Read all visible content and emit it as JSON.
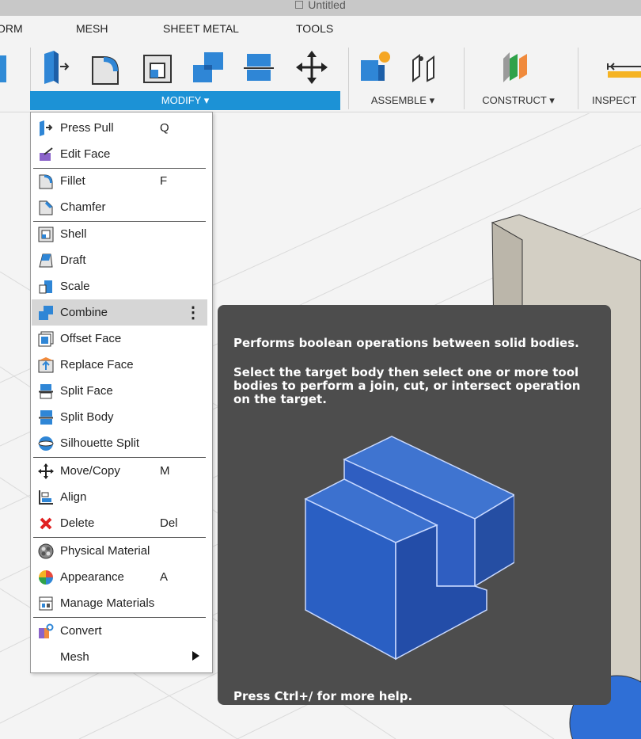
{
  "window": {
    "title": "Untitled"
  },
  "ribbon": {
    "tabs": [
      "ORM",
      "MESH",
      "SHEET METAL",
      "TOOLS"
    ],
    "groups": {
      "modify": "MODIFY ▾",
      "assemble": "ASSEMBLE ▾",
      "construct": "CONSTRUCT ▾",
      "inspect": "INSPECT"
    },
    "tool_icons": [
      "press-pull-icon",
      "fillet-icon",
      "shell-icon",
      "combine-icon",
      "split-body-icon",
      "move-icon",
      "new-component-icon",
      "joint-icon",
      "offset-plane-icon",
      "measure-icon"
    ]
  },
  "menu": {
    "items": [
      {
        "label": "Press Pull",
        "shortcut": "Q",
        "icon": "press-pull-icon"
      },
      {
        "label": "Edit Face",
        "shortcut": "",
        "icon": "edit-face-icon"
      },
      {
        "label": "Fillet",
        "shortcut": "F",
        "icon": "fillet-icon"
      },
      {
        "label": "Chamfer",
        "shortcut": "",
        "icon": "chamfer-icon"
      },
      {
        "label": "Shell",
        "shortcut": "",
        "icon": "shell-icon"
      },
      {
        "label": "Draft",
        "shortcut": "",
        "icon": "draft-icon"
      },
      {
        "label": "Scale",
        "shortcut": "",
        "icon": "scale-icon"
      },
      {
        "label": "Combine",
        "shortcut": "",
        "icon": "combine-icon",
        "more": "⋮"
      },
      {
        "label": "Offset Face",
        "shortcut": "",
        "icon": "offset-face-icon"
      },
      {
        "label": "Replace Face",
        "shortcut": "",
        "icon": "replace-face-icon"
      },
      {
        "label": "Split Face",
        "shortcut": "",
        "icon": "split-face-icon"
      },
      {
        "label": "Split Body",
        "shortcut": "",
        "icon": "split-body-icon"
      },
      {
        "label": "Silhouette Split",
        "shortcut": "",
        "icon": "silhouette-split-icon"
      },
      {
        "label": "Move/Copy",
        "shortcut": "M",
        "icon": "move-copy-icon"
      },
      {
        "label": "Align",
        "shortcut": "",
        "icon": "align-icon"
      },
      {
        "label": "Delete",
        "shortcut": "Del",
        "icon": "delete-icon"
      },
      {
        "label": "Physical Material",
        "shortcut": "",
        "icon": "physical-material-icon"
      },
      {
        "label": "Appearance",
        "shortcut": "A",
        "icon": "appearance-icon"
      },
      {
        "label": "Manage Materials",
        "shortcut": "",
        "icon": "manage-materials-icon"
      },
      {
        "label": "Convert",
        "shortcut": "",
        "icon": "convert-icon"
      },
      {
        "label": "Mesh",
        "shortcut": "",
        "icon": ""
      }
    ]
  },
  "tooltip": {
    "summary": "Performs boolean operations between solid bodies.",
    "detail": "Select the target body then select one or more tool bodies to perform a join, cut, or intersect operation on the target.",
    "footer": "Press Ctrl+/ for more help."
  },
  "colors": {
    "accent": "#1c92d6",
    "tooltip_bg": "#4d4d4d",
    "highlight": "#d6d6d6",
    "body_blue": "#1f5fd1"
  }
}
